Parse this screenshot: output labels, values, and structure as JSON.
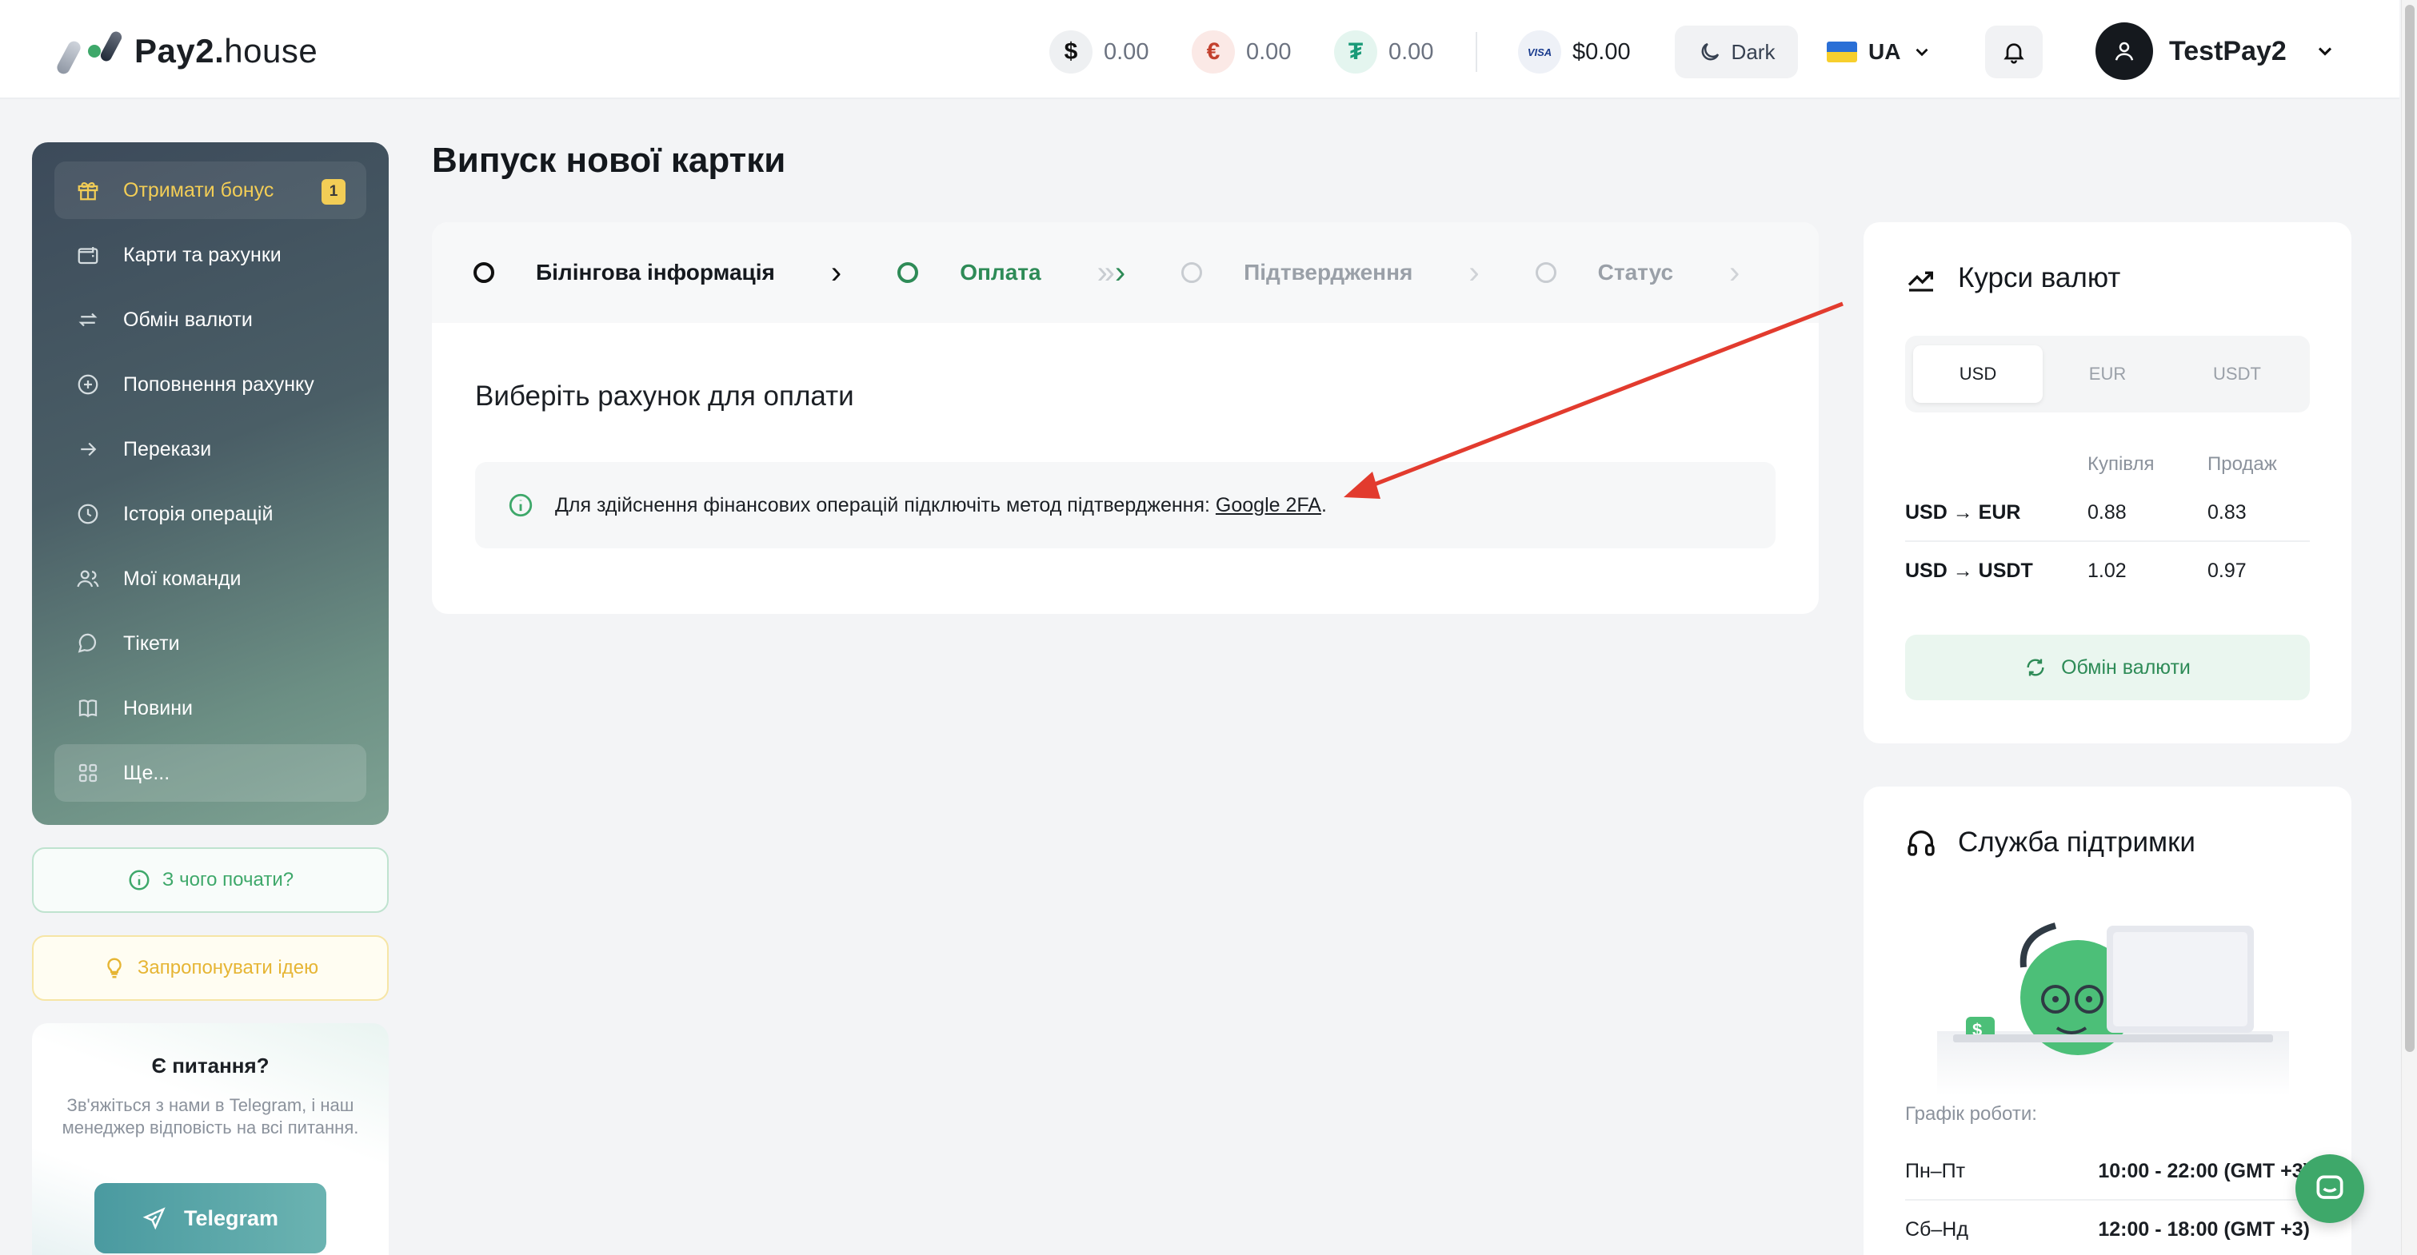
{
  "brand": {
    "name_bold": "Pay2.",
    "name_light": "house"
  },
  "header": {
    "balances": [
      {
        "symbol": "$",
        "amount": "0.00",
        "icon": "dollar-coin-icon"
      },
      {
        "symbol": "€",
        "amount": "0.00",
        "icon": "euro-coin-icon"
      },
      {
        "symbol": "₮",
        "amount": "0.00",
        "icon": "tether-coin-icon"
      }
    ],
    "visa": {
      "mark": "VISA",
      "amount": "$0.00"
    },
    "theme_label": "Dark",
    "language": "UA",
    "username": "TestPay2"
  },
  "sidebar": {
    "items": [
      {
        "label": "Отримати бонус",
        "icon": "gift-icon",
        "badge": "1"
      },
      {
        "label": "Карти та рахунки",
        "icon": "wallet-icon"
      },
      {
        "label": "Обмін валюти",
        "icon": "swap-icon"
      },
      {
        "label": "Поповнення рахунку",
        "icon": "plus-circle-icon"
      },
      {
        "label": "Перекази",
        "icon": "arrow-right-icon"
      },
      {
        "label": "Історія операцій",
        "icon": "clock-icon"
      },
      {
        "label": "Мої команди",
        "icon": "users-icon"
      },
      {
        "label": "Тікети",
        "icon": "chat-icon"
      },
      {
        "label": "Новини",
        "icon": "book-icon"
      },
      {
        "label": "Ще...",
        "icon": "grid-icon"
      }
    ],
    "start_button": "З чого почати?",
    "idea_button": "Запропонувати ідею",
    "help": {
      "title": "Є питання?",
      "text": "Зв'яжіться з нами в Telegram, і наш менеджер відповість на всі питання.",
      "button": "Telegram"
    }
  },
  "main": {
    "title": "Випуск нової картки",
    "steps": [
      {
        "label": "Білінгова інформація",
        "state": "done"
      },
      {
        "label": "Оплата",
        "state": "active"
      },
      {
        "label": "Підтвердження",
        "state": "pending"
      },
      {
        "label": "Статус",
        "state": "pending"
      }
    ],
    "section_title": "Виберіть рахунок для оплати",
    "notice_text": "Для здійснення фінансових операцій підключіть метод підтвердження: ",
    "notice_link": "Google 2FA",
    "notice_end": "."
  },
  "rates": {
    "title": "Курси валют",
    "tabs": [
      "USD",
      "EUR",
      "USDT"
    ],
    "selected_tab": "USD",
    "col_buy": "Купівля",
    "col_sell": "Продаж",
    "rows": [
      {
        "pair": "USD → EUR",
        "buy": "0.88",
        "sell": "0.83"
      },
      {
        "pair": "USD → USDT",
        "buy": "1.02",
        "sell": "0.97"
      }
    ],
    "exchange_button": "Обмін валюти"
  },
  "support": {
    "title": "Служба підтримки",
    "schedule_title": "Графік роботи:",
    "schedule": [
      {
        "days": "Пн–Пт",
        "hours": "10:00 - 22:00 (GMT +3)"
      },
      {
        "days": "Сб–Нд",
        "hours": "12:00 - 18:00 (GMT +3)"
      }
    ]
  },
  "colors": {
    "accent_green": "#2e8b57",
    "annotation_red": "#e23b2e",
    "badge_yellow": "#f2cd56"
  }
}
